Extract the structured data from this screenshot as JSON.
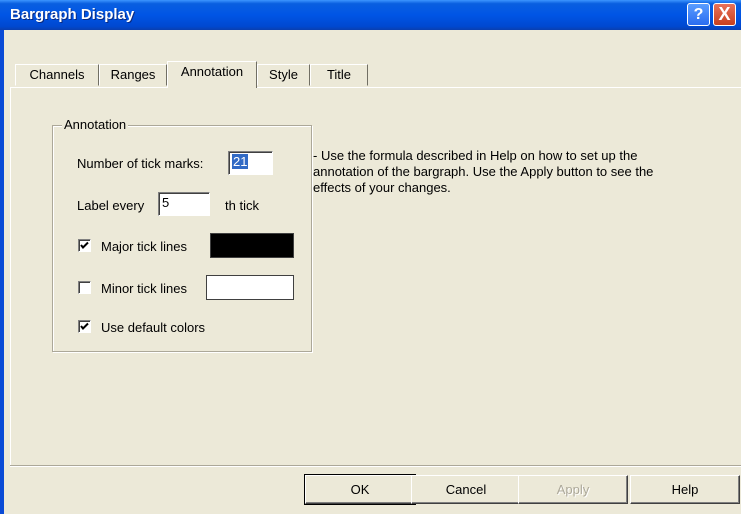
{
  "window": {
    "title": "Bargraph Display",
    "help_glyph": "?",
    "close_glyph": "X"
  },
  "tabs": [
    {
      "label": "Channels"
    },
    {
      "label": "Ranges"
    },
    {
      "label": "Annotation",
      "active": true
    },
    {
      "label": "Style"
    },
    {
      "label": "Title"
    }
  ],
  "annotation": {
    "group_label": "Annotation",
    "tick_marks_label": "Number of tick marks:",
    "tick_marks_value": "21",
    "label_every_label": "Label every",
    "label_every_value": "5",
    "th_tick_label": "th tick",
    "major_tick_label": "Major tick lines",
    "major_tick_checked": true,
    "major_tick_color": "#000000",
    "minor_tick_label": "Minor tick lines",
    "minor_tick_checked": false,
    "minor_tick_color": "#ffffff",
    "default_colors_label": "Use default colors",
    "default_colors_checked": true
  },
  "help_text": "- Use the formula described in Help on how to set up the annotation of the bargraph.  Use the Apply button to see the effects of your changes.",
  "buttons": {
    "ok": "OK",
    "cancel": "Cancel",
    "apply": "Apply",
    "help": "Help"
  }
}
